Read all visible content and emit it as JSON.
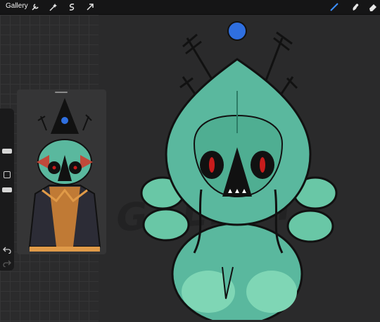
{
  "topbar": {
    "gallery_label": "Gallery",
    "tools": [
      "wrench-icon",
      "magic-wand-icon",
      "selection-icon",
      "transform-arrow-icon"
    ],
    "right_tools": [
      "brush-icon",
      "smudge-icon",
      "eraser-icon"
    ],
    "accent": "#3b8fff"
  },
  "canvas": {
    "watermark_text": "GALEXY"
  },
  "colors": {
    "teal": "#5ab89e",
    "teal_light": "#7fd6b5",
    "outline": "#111111",
    "eye_red": "#c81c1c",
    "orb_blue": "#2f6fe0"
  }
}
